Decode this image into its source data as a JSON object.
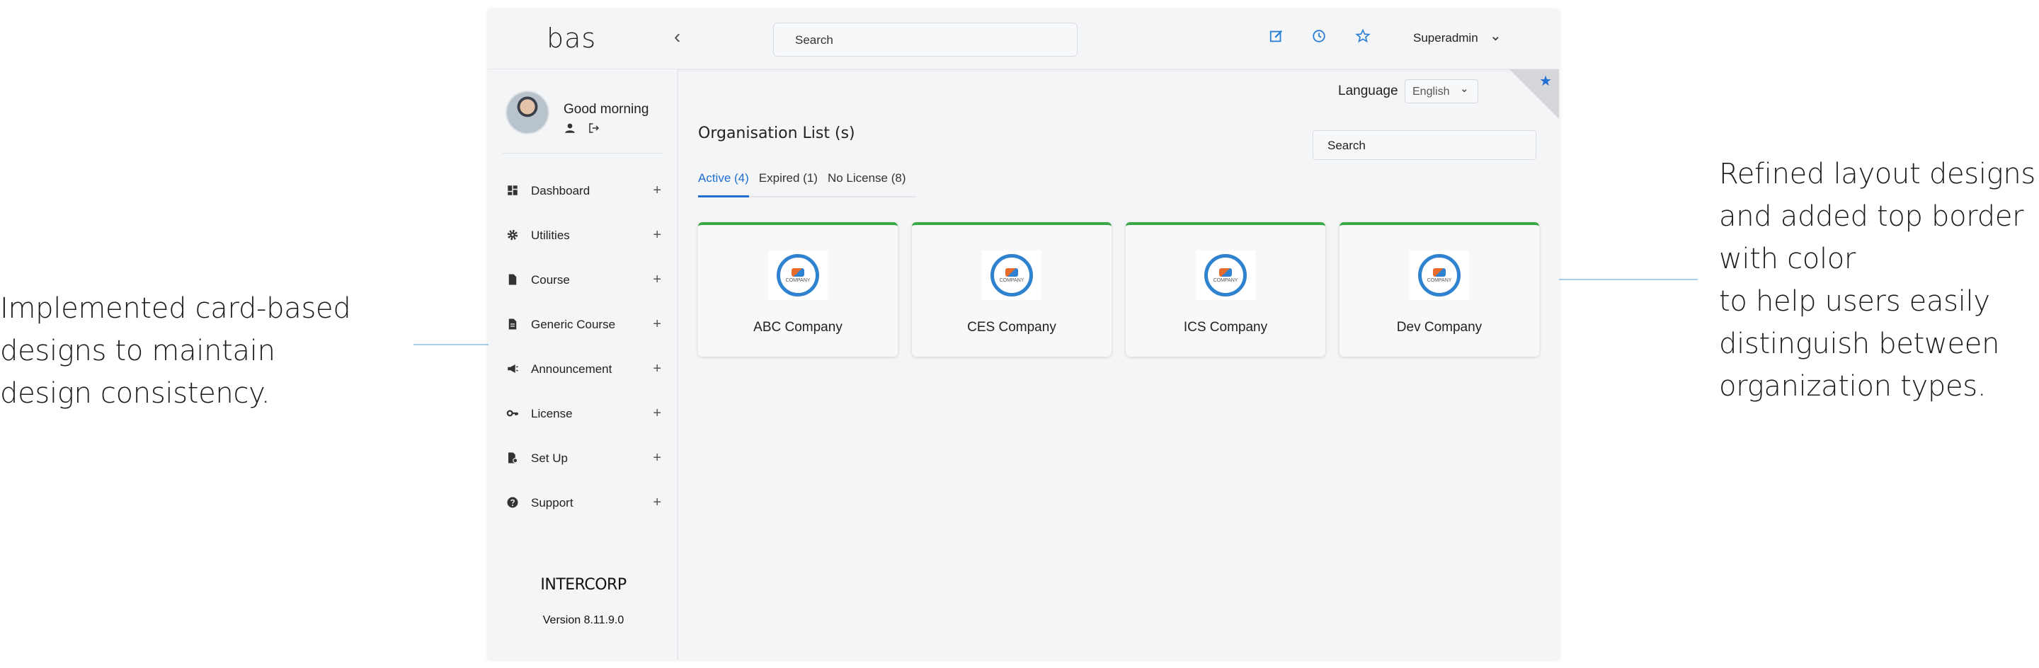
{
  "annotations": {
    "left": [
      "Implemented card-based",
      "designs to maintain",
      "design consistency."
    ],
    "right": [
      "Refined layout designs",
      "and added top border",
      "with color",
      "to help users easily",
      "distinguish between",
      "organization types."
    ]
  },
  "topbar": {
    "logo": "bas",
    "search_placeholder": "Search",
    "user": "Superadmin"
  },
  "sidebar": {
    "greeting": "Good morning",
    "items": [
      {
        "label": "Dashboard"
      },
      {
        "label": "Utilities"
      },
      {
        "label": "Course"
      },
      {
        "label": "Generic Course"
      },
      {
        "label": "Announcement"
      },
      {
        "label": "License"
      },
      {
        "label": "Set Up"
      },
      {
        "label": "Support"
      }
    ],
    "brand": "INTERCORP",
    "version": "Version 8.11.9.0"
  },
  "main": {
    "language_label": "Language",
    "language_value": "English",
    "title": "Organisation List (s)",
    "search_placeholder": "Search",
    "tabs": [
      {
        "label": "Active (4)"
      },
      {
        "label": "Expired (1)"
      },
      {
        "label": "No License (8)"
      }
    ],
    "cards": [
      {
        "name": "ABC Company",
        "logo_text": "COMPANY"
      },
      {
        "name": "CES Company",
        "logo_text": "COMPANY"
      },
      {
        "name": "ICS Company",
        "logo_text": "COMPANY"
      },
      {
        "name": "Dev Company",
        "logo_text": "COMPANY"
      }
    ]
  },
  "colors": {
    "accent": "#1f6fd0",
    "card_border": "#3aa845",
    "annotation_dot": "#2d8cd6"
  }
}
